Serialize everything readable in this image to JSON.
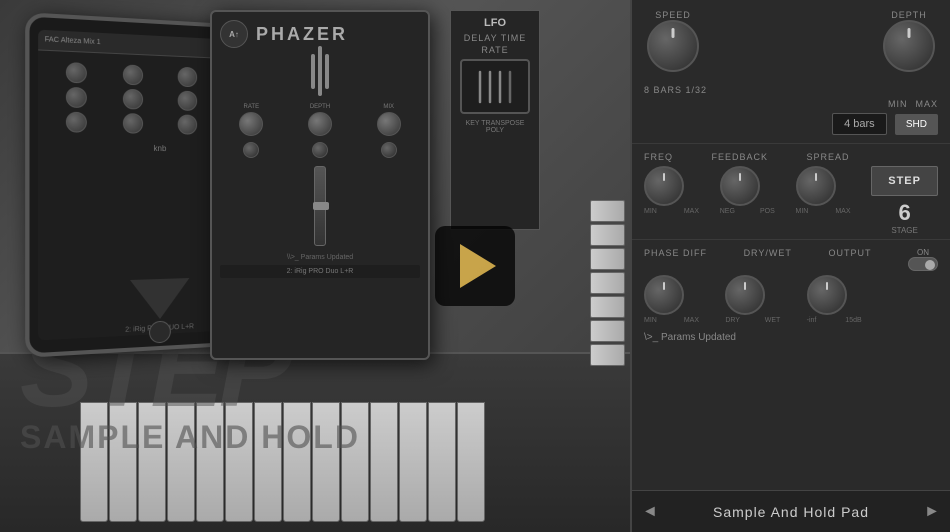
{
  "video": {
    "play_button_label": "▶"
  },
  "watermark": {
    "step_text": "STEP",
    "subtitle": "Sample And Hold"
  },
  "tablet": {
    "plugin_name": "FAC Alteza Mix 1",
    "knobs_label": "knb"
  },
  "phazer": {
    "title": "PHAZER",
    "logo_text": "A↑Z"
  },
  "lfo": {
    "title": "LFO",
    "delay_time_label": "DELAY TIME",
    "rate_label": "RATE",
    "key_transpose": "KEY TRANSPOSE",
    "poly_label": "POLY"
  },
  "main_panel": {
    "speed_label": "SPEED",
    "depth_label": "DEPTH",
    "min_label": "MIN",
    "max_label": "MAX",
    "shd_label": "SHD",
    "bars_label": "4 bars",
    "bars_sub_label": "8 Bars  1/32",
    "freq_label": "FREQ",
    "feedback_label": "FEEDBACK",
    "spread_label": "SPREAD",
    "step_button": "STEP",
    "stage_number": "6",
    "stage_label": "STAGE",
    "freq_range": {
      "min": "MIN",
      "max": "MAX"
    },
    "feedback_range": {
      "min": "NEG",
      "max": "POS"
    },
    "spread_range": {
      "min": "MIN",
      "max": "MAX"
    },
    "phase_diff_label": "PHASE DIFF",
    "drywet_label": "DRY/WET",
    "output_label": "OUTPUT",
    "on_label": "ON",
    "phase_range": {
      "min": "MIN",
      "max": "MAX"
    },
    "drywet_range": {
      "min": "DRY",
      "max": "WET"
    },
    "output_range": {
      "min": "-inf",
      "max": "15dB"
    },
    "params_updated": "\\>_ Params Updated",
    "preset_name": "Sample And Hold Pad",
    "prev_arrow": "◄",
    "next_arrow": "►"
  }
}
